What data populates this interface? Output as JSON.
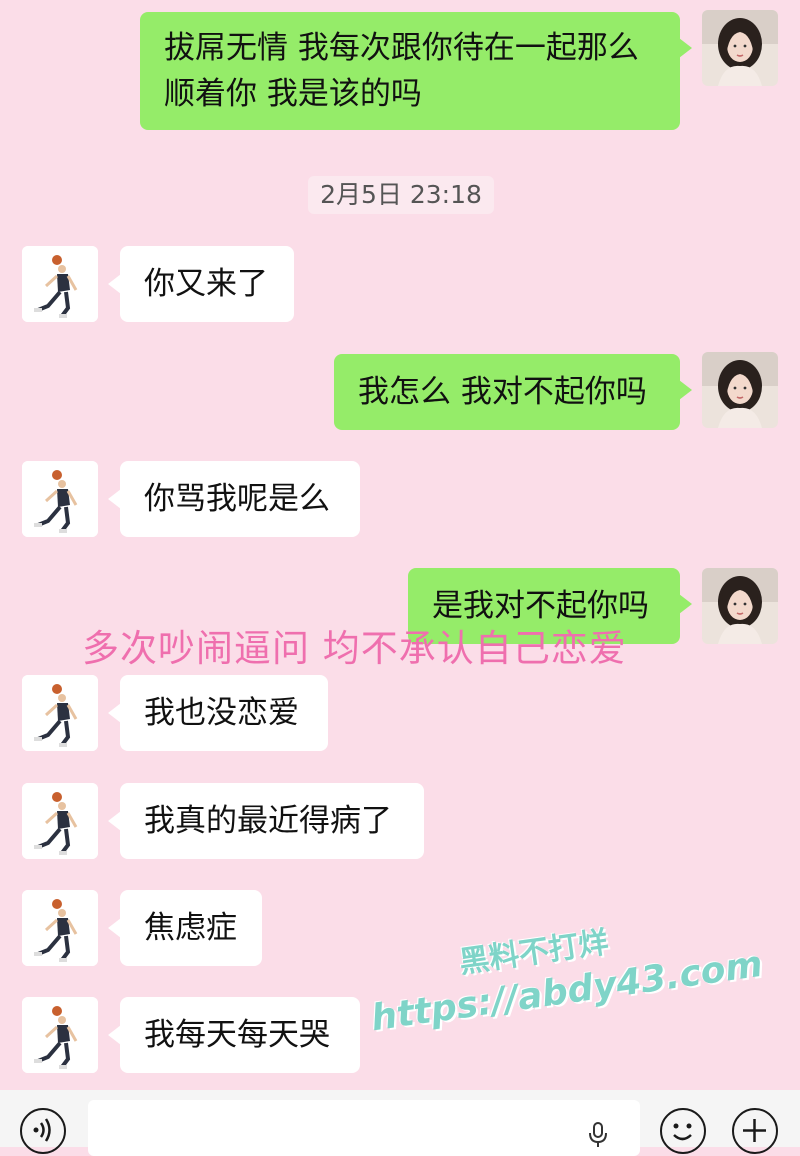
{
  "messages": [
    {
      "side": "right",
      "lines": [
        "拔屌无情 我每次跟你待在一起那么",
        "顺着你 我是该的吗"
      ]
    },
    {
      "side": "left",
      "lines": [
        "你又来了"
      ]
    },
    {
      "side": "right",
      "lines": [
        "我怎么 我对不起你吗"
      ]
    },
    {
      "side": "left",
      "lines": [
        "你骂我呢是么"
      ]
    },
    {
      "side": "right",
      "lines": [
        "是我对不起你吗"
      ]
    },
    {
      "side": "left",
      "lines": [
        "我也没恋爱"
      ]
    },
    {
      "side": "left",
      "lines": [
        "我真的最近得病了"
      ]
    },
    {
      "side": "left",
      "lines": [
        "焦虑症"
      ]
    },
    {
      "side": "left",
      "lines": [
        "我每天每天哭"
      ]
    }
  ],
  "timestamp": "2月5日 23:18",
  "annotation": "多次吵闹逼问 均不承认自己恋爱",
  "watermark": {
    "line1": "黑料不打烊",
    "line2": "https://abdy43.com"
  },
  "input_bar": {
    "text_value": "",
    "icons": [
      "voice-icon",
      "microphone-icon",
      "emoji-icon",
      "plus-icon"
    ]
  },
  "colors": {
    "background": "#fbdde8",
    "sent_bubble": "#95ec69",
    "received_bubble": "#ffffff",
    "annotation": "#ef6fae",
    "watermark": "#7fd4c8"
  }
}
